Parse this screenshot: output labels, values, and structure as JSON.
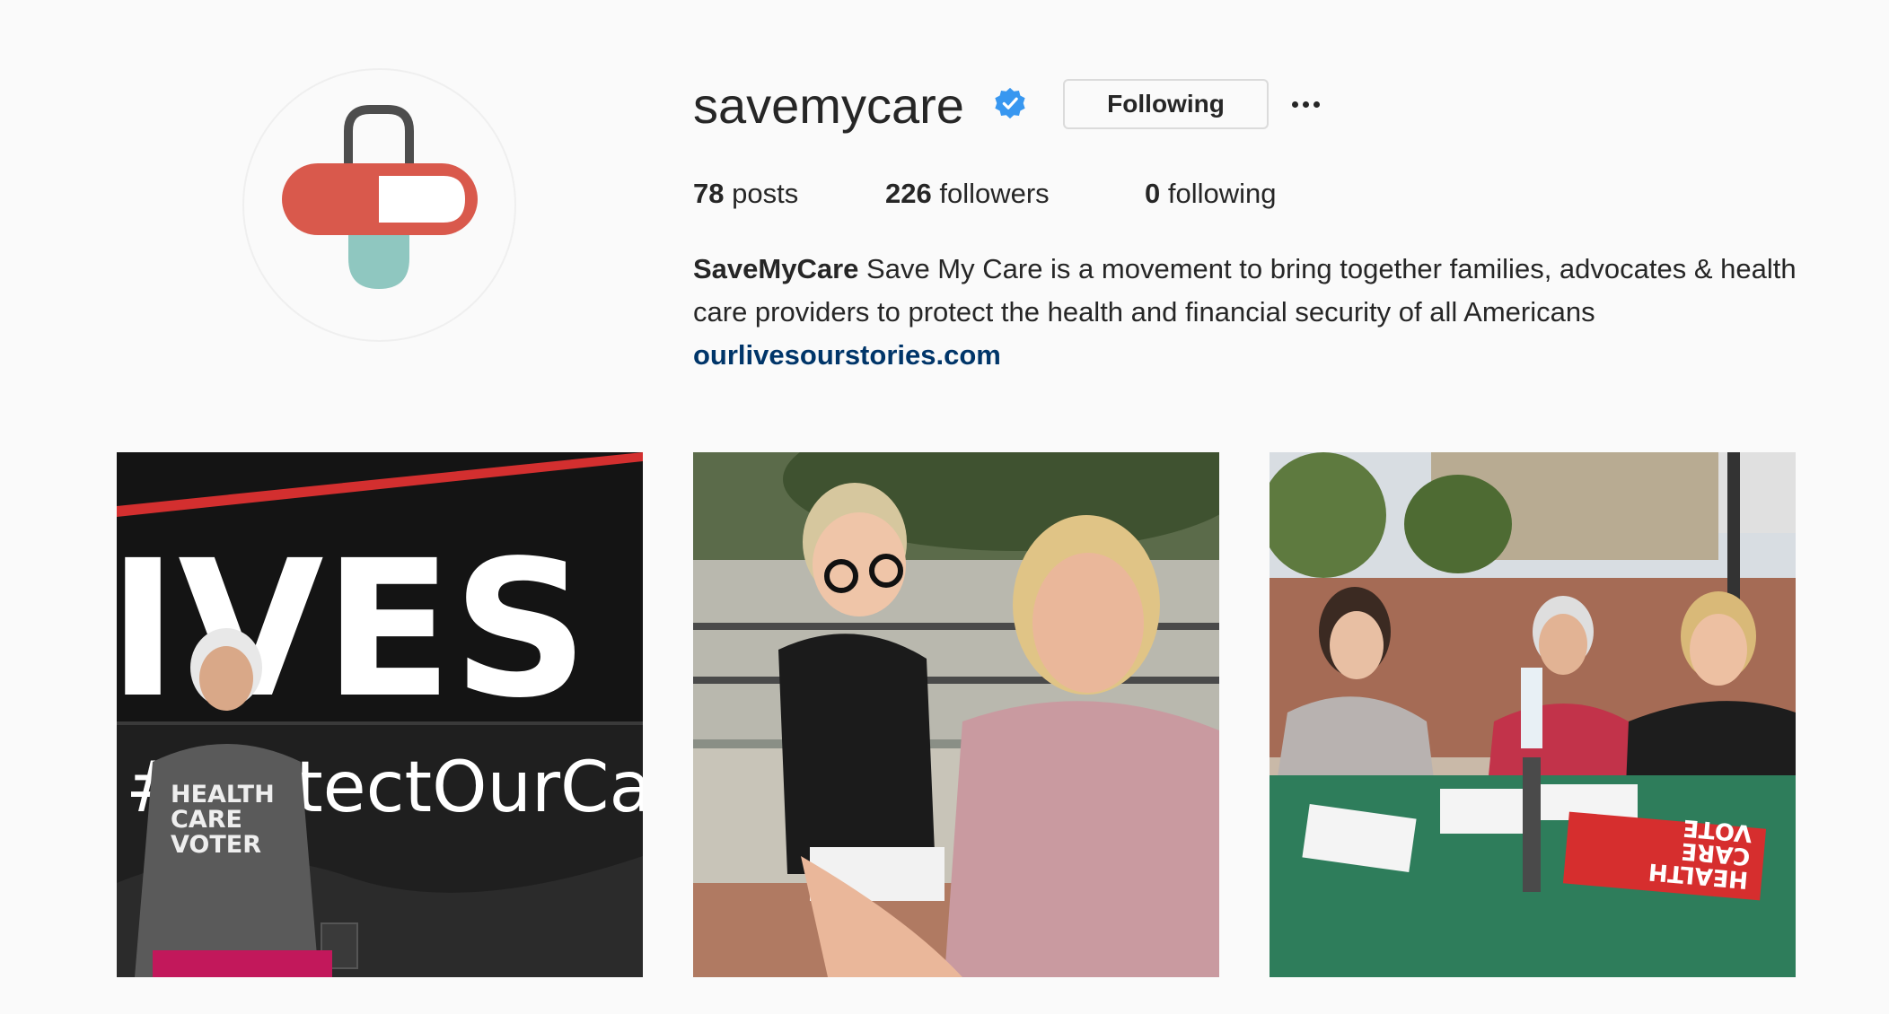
{
  "profile": {
    "username": "savemycare",
    "verified": true,
    "follow_button_label": "Following",
    "more_options": "more-horizontal-icon",
    "stats": {
      "posts_count": "78",
      "posts_label": "posts",
      "followers_count": "226",
      "followers_label": "followers",
      "following_count": "0",
      "following_label": "following"
    },
    "bio": {
      "full_name": "SaveMyCare",
      "text": "Save My Care is a movement to bring together families, advocates & health care providers to protect the health and financial security of all Americans",
      "link": "ourlivesourstories.com"
    },
    "avatar_icon": "pill-lock-logo-icon"
  },
  "posts": [
    {
      "image_description_text": {
        "bus_text_large": "IVES",
        "bus_text_hashtag": "#ProtectOurCare",
        "shirt_text": [
          "HEALTH",
          "CARE",
          "VOTER"
        ]
      }
    },
    {
      "image_description_text": {}
    },
    {
      "image_description_text": {
        "sign_text": [
          "HEALTH",
          "CARE",
          "VOTE"
        ]
      }
    }
  ],
  "colors": {
    "background": "#fafafa",
    "link": "#003569",
    "verified_badge": "#3897f0",
    "logo_red": "#d9594c",
    "logo_teal": "#8fc7c0",
    "logo_gray": "#4d4d4d"
  }
}
